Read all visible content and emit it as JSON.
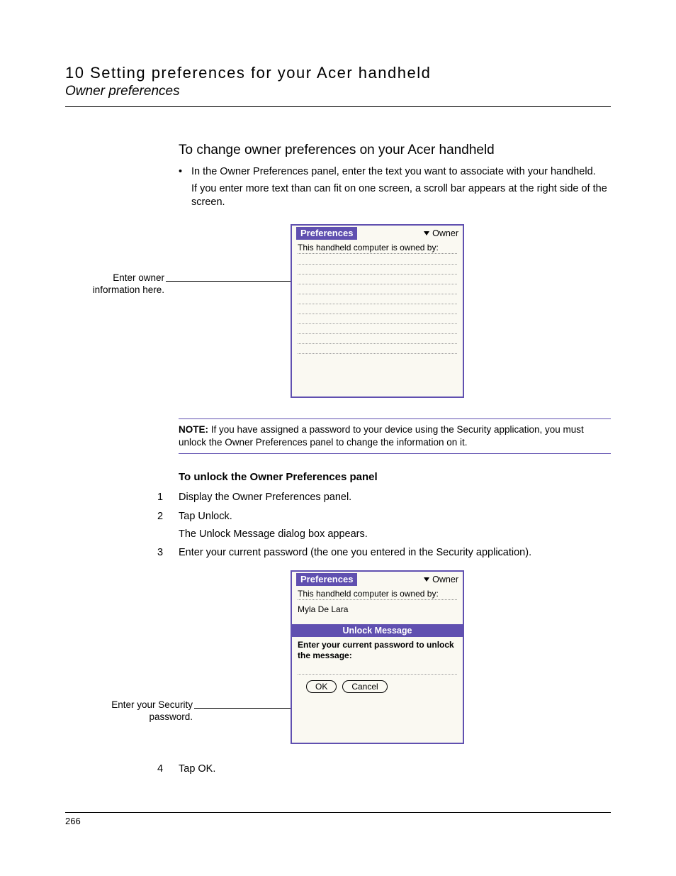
{
  "header": {
    "chapter": "10 Setting preferences for your Acer handheld",
    "section": "Owner preferences"
  },
  "heading": "To change owner preferences on your Acer handheld",
  "bullet": "In the Owner Preferences panel, enter the text you want to associate with your handheld.",
  "bullet_sub": "If you enter more text than can fit on one screen, a scroll bar appears at the right side of the screen.",
  "fig1": {
    "callout": "Enter owner information here.",
    "screen": {
      "title": "Preferences",
      "dropdown": "Owner",
      "prompt": "This handheld computer is owned by:"
    }
  },
  "note": {
    "label": "NOTE:",
    "text": "If you have assigned a password to your device using the Security application, you must unlock the Owner Preferences panel to change the information on it."
  },
  "sub_heading": "To unlock the Owner Preferences panel",
  "steps": {
    "s1_num": "1",
    "s1": "Display the Owner Preferences panel.",
    "s2_num": "2",
    "s2": "Tap Unlock.",
    "s2_sub": "The Unlock Message dialog box appears.",
    "s3_num": "3",
    "s3": "Enter your current password (the one you entered in the Security application).",
    "s4_num": "4",
    "s4": "Tap OK."
  },
  "fig2": {
    "callout": "Enter your Security password.",
    "screen": {
      "title": "Preferences",
      "dropdown": "Owner",
      "prompt": "This handheld computer is owned by:",
      "owner_name": "Myla De Lara",
      "dialog_title": "Unlock Message",
      "dialog_prompt": "Enter your current password to unlock the message:",
      "ok": "OK",
      "cancel": "Cancel"
    }
  },
  "page_number": "266"
}
